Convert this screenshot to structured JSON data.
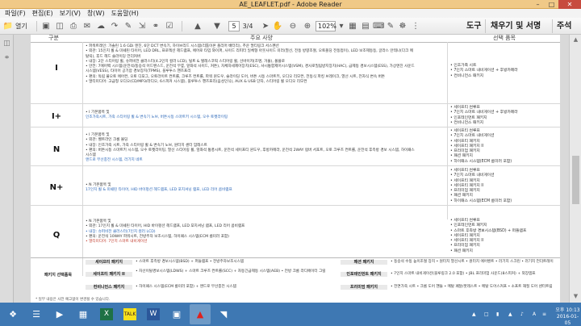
{
  "window": {
    "title": "AE_LEAFLET.pdf - Adobe Reader"
  },
  "menu": [
    "파일(F)",
    "편집(E)",
    "보기(V)",
    "창(W)",
    "도움말(H)"
  ],
  "toolbar": {
    "open_label": "열기",
    "page_current": "5",
    "page_total": "3/4",
    "zoom": "102%",
    "tools_label": "도구",
    "sign_label": "채우기 및 서명",
    "comment_label": "주석"
  },
  "document": {
    "headers": {
      "grade": "구분",
      "specs": "주요 사양",
      "options": "선택 품목"
    },
    "rows": [
      {
        "grade": "I",
        "specs": [
          "• 파워트레인: 가솔린 1.6 GDi 엔진, 6단 DCT 변속기, 하이브리드 시스템(리튬이온 폴리머 배터리), 추운 멀티링크 서스펜션",
          "• 외관: 15인치 휠 & 미쉐린 타이어, LED DRL, 프로젝션 헤드램프, 에어로 타입 와이퍼, 사이드 리피터 일체형 아웃사이드 미러(열선, 전동 방향조절, 오토폴딩 전동접이), LED 보조제동등, 글라스 안테나(다크 메탈릭), 후드 헤드 슬라이딩 언더커버",
          "• 내장: 2단 스티어링 휠, 슈퍼비전 클러스터(4.2인치 컬러 LCD), 틸트 & 텔레스코픽 스티어링 휠, 선바이저(조명, 거울), 볼플로",
          "• 안전: 7에어백 시스템(운전석/동승석 어드밴스드, 운전석 무릎, 앞좌석 사이드, 커튼), 차체자세제어장치(ESC), 샤시통합제어시스템(VSM), 경사로밀림방지장치(HAC), 급제동 경보시스템(ESS), 가상엔진 사운드 시스템(VESS), 타이어 공기압 경보장치(TPMS), 블루투스 핸즈프리",
          "• 편의: 독립 풀오토 에어컨, 오토 디포그, 오토라이트 컨트롤, 크루즈 컨트롤, 파워 윈도우, 슬라이딩 도어, 버튼 시동 스마트키, 오디오 리모컨, 전동식 파킹 브레이크, 열선 시트, 전자식 변속 버튼",
          "• 멀티미디어: 고급형 오디오(CD/MP3/라디오, 6스피커 시스템), 블루투스 핸즈프리(음성인식), AUX & USB 단자, 스티어링 휠 오디오 리모컨"
        ],
        "options": [
          "• 인조가죽 시트",
          "• 7인치 스마트 내비게이션 + 후방카메라",
          "• 컨비니언스 패키지"
        ]
      },
      {
        "grade": "I+",
        "specs": [
          "• I 기본품목 및",
          "  인조가죽시트, 가죽 스티어링 휠 & 변속기 노브, 버튼시동 스마트키 시스템, 오수 토켓라이팅"
        ],
        "options": [
          "• 세이프티 썬루프",
          "• 7인치 스마트 내비게이션 + 후방카메라",
          "• 인포테인먼트 패키지",
          "• 컨비니언스 패키지"
        ]
      },
      {
        "grade": "N",
        "specs": [
          "• I 기본품목 및",
          "• 외관: 벨트라인 크롬 몰딩",
          "• 내장: 인조가죽 시트, 가죽 스티어링 휠 & 변속기 노브, 원터치 센터 암레스트",
          "• 편의: 버튼시동 스마트키 시스템, 오수 토켓라이팅, 열선 스티어링 휠, 앞좌석 통풍시트, 운전석 세이프티 윈도우, 후방카메라, 운전석 2WAY 럼버 서포트, 오토 크루즈 컨트롤, 운전석 후측방 경보 시스템, 하이패스 시스템",
          "  앤드로 무선충전 시스템, 러기지 네트"
        ],
        "options": [
          "• 세이프티 썬루프",
          "• 7인치 스마트 내비게이션",
          "• 세이프티 패키지",
          "• 세이프티 패키지 II",
          "• 프리미엄 패키지",
          "• 패션 패키지",
          "• 하이패스 시스템(ECM 룸미러 포함)"
        ]
      },
      {
        "grade": "N+",
        "specs": [
          "• N 기본품목 및",
          "  17인치 휠 & 미쉐린 타이어, HID 바이펑션 헤드램프, LED 포지셔닝 램프, LED 리어 콤비램프"
        ],
        "options": [
          "• 세이프티 썬루프",
          "• 7인치 스마트 내비게이션",
          "• 세이프티 패키지",
          "• 세이프티 패키지 II",
          "• 프리미엄 패키지",
          "• 패션 패키지",
          "• 하이패스 시스템(ECM 룸미러 포함)"
        ]
      },
      {
        "grade": "Q",
        "specs": [
          "• N 기본품목 및",
          "• 외관: 17인치 휠 & 미쉐린 타이어, HID 바이펑션 헤드램프, LED 포지셔닝 램프, LED 리어 콤비램프",
          "• 내장: 슈퍼비전 클러스터(7인치 컬러 LCD)",
          "• 편의: 운전석 10WAY 파워시트, 전방주차 보조시스템, 하이패스 시스템(ECM 룸미러 포함)",
          "• 멀티미디어: 7인치 스마트 내비게이션"
        ],
        "options": [
          "• 세이프티 썬루프",
          "• 인포테인먼트 패키지",
          "• 스마트 후측방 경보시스템(BSD) + 퍼들램프",
          "• 세이프티 패키지",
          "• 세이프티 패키지 II",
          "• 프리미엄 패키지",
          "• 패션 패키지"
        ]
      }
    ],
    "packages": {
      "section_label": "패키지 선택품목",
      "items": [
        {
          "name": "세이프티 패키지",
          "desc": "• 스마트 후측방 경보시스템(BSD) + 퍼들램프 • 전방주차보조시스템"
        },
        {
          "name": "패션 패키지",
          "desc": "• 동승석 수동 높이조절 장치 • 원터치 열선시트 • 원터치 에어벤트 • 러기지 스크린 • 러기지 언더트레이"
        },
        {
          "name": "세이프티 패키지 II",
          "desc": "• 차선이탈경보시스템(LDWS) + 스마트 크루즈 컨트롤(SCC) + 자동긴급제동 시스템(AEB) • 전방 크롬 라디에이터 그릴"
        },
        {
          "name": "인포테인먼트 패키지",
          "desc": "• 7인치 스마트 내비게이션(블루링크 2.0 포함) • JBL 프리미엄 사운드(8스피커) + 외장앰프"
        },
        {
          "name": "컨비니언스 패키지",
          "desc": "• 하이패스 시스템(ECM 룸미러 포함) + 앤드로 무선충전 시스템"
        },
        {
          "name": "프리미엄 패키지",
          "desc": "• 전면가죽 시트 • 크롬 도어 핸들 • 메탈 페달/풋레스트 • 메탈 도어스커프 • 소프트 재질 도어 센터트림"
        }
      ],
      "footnote": "* 일부 내용은 사전 예고없이 변경될 수 있습니다."
    }
  },
  "taskbar": {
    "apps": [
      "start-icon",
      "explorer-icon",
      "media-player-icon",
      "store-icon",
      "excel-icon",
      "kakaotalk-icon",
      "word-icon",
      "photo-viewer-icon",
      "adobe-reader-icon",
      "file-manager-icon"
    ],
    "clock_time": "오후 10:13",
    "clock_date": "2016-01-05"
  }
}
